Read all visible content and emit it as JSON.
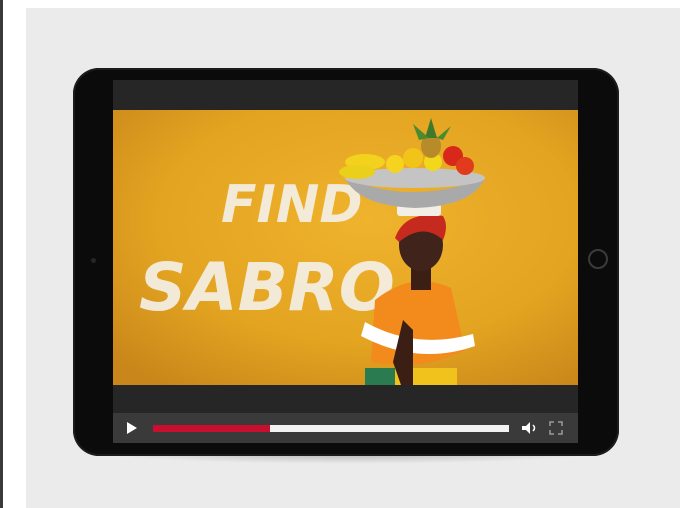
{
  "video": {
    "caption_line1": "FIND",
    "caption_line2": "SABRO",
    "background_color": "#e3a421"
  },
  "player": {
    "progress": 0.33,
    "progress_color": "#c8102e",
    "controls": [
      "play-icon",
      "progress-bar",
      "volume-icon",
      "fullscreen-icon"
    ]
  }
}
